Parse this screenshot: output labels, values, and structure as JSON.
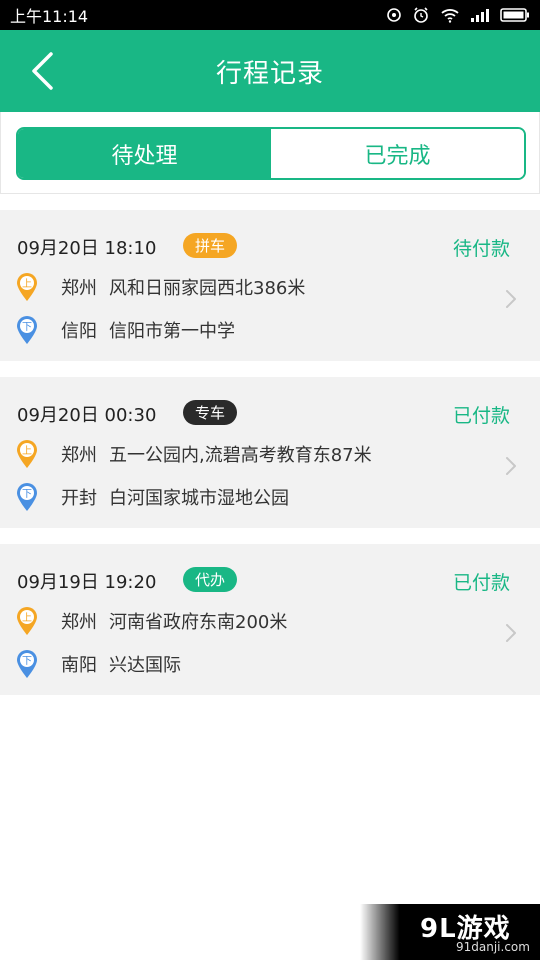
{
  "status_bar": {
    "time": "上午11:14"
  },
  "header": {
    "title": "行程记录"
  },
  "tabs": [
    {
      "label": "待处理",
      "active": true
    },
    {
      "label": "已完成",
      "active": false
    }
  ],
  "trips": [
    {
      "time": "09月20日 18:10",
      "type": "拼车",
      "type_color": "#f5a623",
      "status": "待付款",
      "pickup": {
        "marker": "上",
        "city": "郑州",
        "address": "风和日丽家园西北386米"
      },
      "dropoff": {
        "marker": "下",
        "city": "信阳",
        "address": "信阳市第一中学"
      }
    },
    {
      "time": "09月20日 00:30",
      "type": "专车",
      "type_color": "#2a2a2a",
      "status": "已付款",
      "pickup": {
        "marker": "上",
        "city": "郑州",
        "address": "五一公园内,流碧高考教育东87米"
      },
      "dropoff": {
        "marker": "下",
        "city": "开封",
        "address": "白河国家城市湿地公园"
      }
    },
    {
      "time": "09月19日 19:20",
      "type": "代办",
      "type_color": "#19b785",
      "status": "已付款",
      "pickup": {
        "marker": "上",
        "city": "郑州",
        "address": "河南省政府东南200米"
      },
      "dropoff": {
        "marker": "下",
        "city": "南阳",
        "address": "兴达国际"
      }
    }
  ],
  "colors": {
    "primary": "#19b785",
    "pickup_pin": "#f5a623",
    "dropoff_pin": "#4a90e2",
    "card_bg": "#f2f2f2"
  },
  "watermark": {
    "logo": "9L游戏",
    "url": "91danji.com"
  },
  "icons": {
    "back": "chevron-left-icon",
    "chevron": "chevron-right-icon",
    "pickup": "pickup-pin-icon",
    "dropoff": "dropoff-pin-icon"
  }
}
